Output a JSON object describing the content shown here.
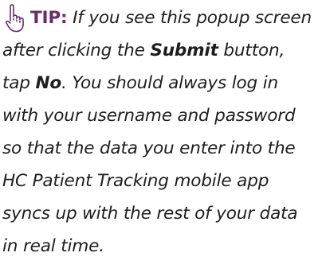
{
  "tip": {
    "label": "TIP:",
    "text_part1": "If you see this popup screen after clicking the ",
    "bold_submit": "Submit",
    "text_part2": " button, tap ",
    "bold_no": "No",
    "text_part3": ". You should always log in with your username and password so that the data you enter into the HC Patient Tracking mobile app syncs up with the rest of your data in real time."
  },
  "icon": {
    "name": "pointing-hand-icon",
    "color": "#6b2b6e"
  }
}
